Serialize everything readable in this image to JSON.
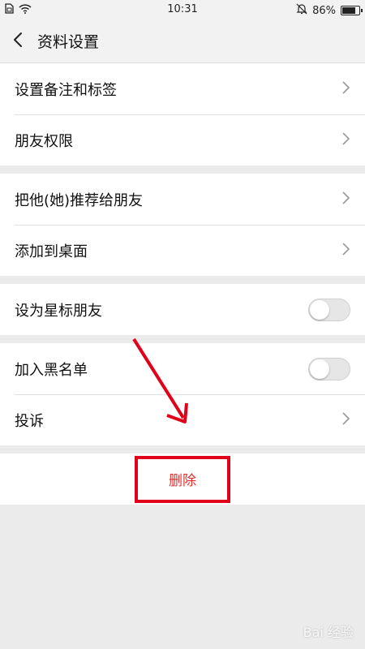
{
  "status_bar": {
    "time": "10:31",
    "battery": "86%",
    "battery_level": 0.86,
    "icons": [
      "sim-icon",
      "wifi-icon",
      "mute-bell-icon",
      "battery-icon"
    ]
  },
  "nav": {
    "title": "资料设置",
    "back_icon": "chevron-left-icon"
  },
  "groups": {
    "g1": {
      "remark_label": "设置备注和标签",
      "perm_label": "朋友权限"
    },
    "g2": {
      "recommend_label": "把他(她)推荐给朋友",
      "desktop_label": "添加到桌面"
    },
    "g3": {
      "star_label": "设为星标朋友",
      "star_on": false
    },
    "g4": {
      "blacklist_label": "加入黑名单",
      "blacklist_on": false,
      "complain_label": "投诉"
    }
  },
  "delete": {
    "label": "删除"
  },
  "colors": {
    "annotation_red": "#e0001a",
    "delete_text": "#e03030"
  },
  "watermark": {
    "text": "Bai 经验"
  }
}
